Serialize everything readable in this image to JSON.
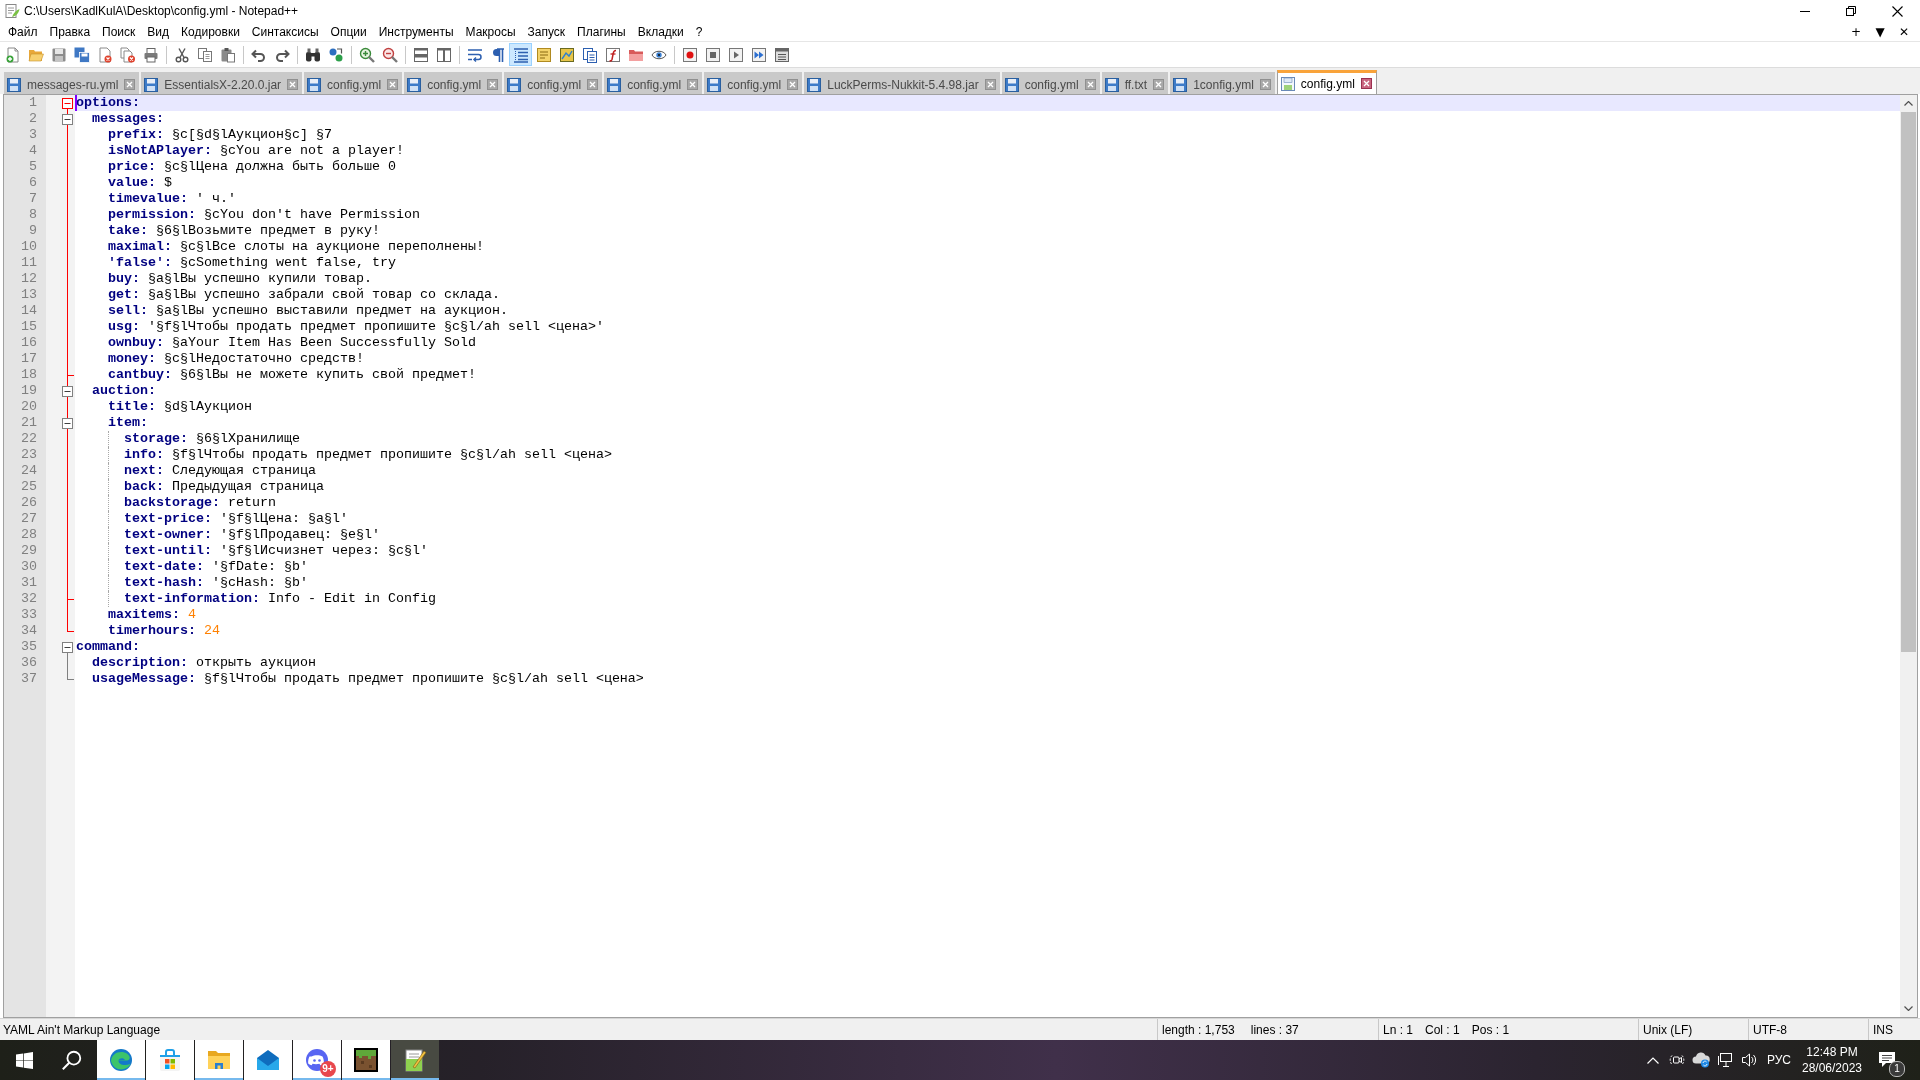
{
  "window": {
    "title": "C:\\Users\\KadlKulA\\Desktop\\config.yml - Notepad++"
  },
  "menu": [
    "Файл",
    "Правка",
    "Поиск",
    "Вид",
    "Кодировки",
    "Синтаксисы",
    "Опции",
    "Инструменты",
    "Макросы",
    "Запуск",
    "Плагины",
    "Вкладки",
    "?"
  ],
  "menu_bar_buttons": [
    "+",
    "▼",
    "✕"
  ],
  "toolbar": [
    [
      {
        "kind": "new",
        "pressed": false
      },
      {
        "kind": "open",
        "pressed": false
      },
      {
        "kind": "save",
        "pressed": false
      },
      {
        "kind": "save-all",
        "pressed": false
      },
      {
        "kind": "close",
        "pressed": false
      },
      {
        "kind": "close-all",
        "pressed": false
      },
      {
        "kind": "print",
        "pressed": false
      }
    ],
    [
      {
        "kind": "cut",
        "pressed": false
      },
      {
        "kind": "copy",
        "pressed": false
      },
      {
        "kind": "paste",
        "pressed": false
      }
    ],
    [
      {
        "kind": "undo",
        "pressed": false
      },
      {
        "kind": "redo",
        "pressed": false
      }
    ],
    [
      {
        "kind": "find",
        "pressed": false
      },
      {
        "kind": "replace",
        "pressed": false
      }
    ],
    [
      {
        "kind": "zoom-in",
        "pressed": false
      },
      {
        "kind": "zoom-out",
        "pressed": false
      }
    ],
    [
      {
        "kind": "sync-vertical",
        "pressed": false
      },
      {
        "kind": "sync-horizontal",
        "pressed": false
      }
    ],
    [
      {
        "kind": "word-wrap",
        "pressed": false
      },
      {
        "kind": "all-chars",
        "pressed": false
      },
      {
        "kind": "indent-guide",
        "pressed": true
      },
      {
        "kind": "udl",
        "pressed": false
      },
      {
        "kind": "doc-map",
        "pressed": false
      },
      {
        "kind": "doc-list",
        "pressed": false
      },
      {
        "kind": "function-list",
        "pressed": false
      },
      {
        "kind": "folder-workspace",
        "pressed": false
      },
      {
        "kind": "monitoring",
        "pressed": false
      }
    ],
    [
      {
        "kind": "record",
        "pressed": false
      },
      {
        "kind": "stop",
        "pressed": false
      },
      {
        "kind": "play",
        "pressed": false
      },
      {
        "kind": "play-multiple",
        "pressed": false
      },
      {
        "kind": "save-macro",
        "pressed": false
      }
    ]
  ],
  "tabs": [
    {
      "label": "messages-ru.yml",
      "selected": false
    },
    {
      "label": "EssentialsX-2.20.0.jar",
      "selected": false
    },
    {
      "label": "config.yml",
      "selected": false
    },
    {
      "label": "config.yml",
      "selected": false
    },
    {
      "label": "config.yml",
      "selected": false
    },
    {
      "label": "config.yml",
      "selected": false
    },
    {
      "label": "config.yml",
      "selected": false
    },
    {
      "label": "LuckPerms-Nukkit-5.4.98.jar",
      "selected": false
    },
    {
      "label": "config.yml",
      "selected": false
    },
    {
      "label": "ff.txt",
      "selected": false
    },
    {
      "label": "1config.yml",
      "selected": false
    },
    {
      "label": "config.yml",
      "selected": true
    }
  ],
  "editor": {
    "lines": [
      {
        "line": "1",
        "kind": "map",
        "key": "options:",
        "expanded": true,
        "caret": true,
        "children": [
          {
            "line": "2",
            "kind": "map",
            "key": "messages:",
            "expanded": true,
            "caret": false,
            "children": [
              {
                "line": "3",
                "kind": "text",
                "key": "prefix:",
                "value": "§c[§d§lАукцион§c] §7",
                "caret": false
              },
              {
                "line": "4",
                "kind": "text",
                "key": "isNotAPlayer:",
                "value": "§cYou are not a player!",
                "caret": false
              },
              {
                "line": "5",
                "kind": "text",
                "key": "price:",
                "value": "§c§lЦена должна быть больше 0",
                "caret": false
              },
              {
                "line": "6",
                "kind": "text",
                "key": "value:",
                "value": "$",
                "caret": false
              },
              {
                "line": "7",
                "kind": "text",
                "key": "timevalue:",
                "value": "' ч.'",
                "caret": false
              },
              {
                "line": "8",
                "kind": "text",
                "key": "permission:",
                "value": "§cYou don't have Permission",
                "caret": false
              },
              {
                "line": "9",
                "kind": "text",
                "key": "take:",
                "value": "§6§lВозьмите предмет в руку!",
                "caret": false
              },
              {
                "line": "10",
                "kind": "text",
                "key": "maximal:",
                "value": "§c§lВсе слоты на аукционе переполнены!",
                "caret": false
              },
              {
                "line": "11",
                "kind": "text",
                "key": "'false':",
                "value": "§cSomething went false, try",
                "caret": false
              },
              {
                "line": "12",
                "kind": "text",
                "key": "buy:",
                "value": "§a§lВы успешно купили товар.",
                "caret": false
              },
              {
                "line": "13",
                "kind": "text",
                "key": "get:",
                "value": "§a§lВы успешно забрали свой товар со склада.",
                "caret": false
              },
              {
                "line": "14",
                "kind": "text",
                "key": "sell:",
                "value": "§a§lВы успешно выставили предмет на аукцион.",
                "caret": false
              },
              {
                "line": "15",
                "kind": "text",
                "key": "usg:",
                "value": "'§f§lЧтобы продать предмет пропишите §c§l/ah sell <цена>'",
                "caret": false
              },
              {
                "line": "16",
                "kind": "text",
                "key": "ownbuy:",
                "value": "§aYour Item Has Been Successfully Sold",
                "caret": false
              },
              {
                "line": "17",
                "kind": "text",
                "key": "money:",
                "value": "§c§lНедостаточно средств!",
                "caret": false
              },
              {
                "line": "18",
                "kind": "text",
                "key": "cantbuy:",
                "value": "§6§lВы не можете купить свой предмет!",
                "caret": false
              }
            ]
          },
          {
            "line": "19",
            "kind": "map",
            "key": "auction:",
            "expanded": true,
            "caret": false,
            "children": [
              {
                "line": "20",
                "kind": "text",
                "key": "title:",
                "value": "§d§lАукцион",
                "caret": false
              },
              {
                "line": "21",
                "kind": "map",
                "key": "item:",
                "expanded": true,
                "caret": false,
                "children": [
                  {
                    "line": "22",
                    "kind": "text",
                    "key": "storage:",
                    "value": "§6§lХранилище",
                    "caret": false
                  },
                  {
                    "line": "23",
                    "kind": "text",
                    "key": "info:",
                    "value": "§f§lЧтобы продать предмет пропишите §c§l/ah sell <цена>",
                    "caret": false
                  },
                  {
                    "line": "24",
                    "kind": "text",
                    "key": "next:",
                    "value": "Следующая страница",
                    "caret": false
                  },
                  {
                    "line": "25",
                    "kind": "text",
                    "key": "back:",
                    "value": "Предыдущая страница",
                    "caret": false
                  },
                  {
                    "line": "26",
                    "kind": "text",
                    "key": "backstorage:",
                    "value": "return",
                    "caret": false
                  },
                  {
                    "line": "27",
                    "kind": "text",
                    "key": "text-price:",
                    "value": "'§f§lЦена: §a§l'",
                    "caret": false
                  },
                  {
                    "line": "28",
                    "kind": "text",
                    "key": "text-owner:",
                    "value": "'§f§lПродавец: §e§l'",
                    "caret": false
                  },
                  {
                    "line": "29",
                    "kind": "text",
                    "key": "text-until:",
                    "value": "'§f§lИсчизнет через: §c§l'",
                    "caret": false
                  },
                  {
                    "line": "30",
                    "kind": "text",
                    "key": "text-date:",
                    "value": "'§fDate: §b'",
                    "caret": false
                  },
                  {
                    "line": "31",
                    "kind": "text",
                    "key": "text-hash:",
                    "value": "'§cHash: §b'",
                    "caret": false
                  },
                  {
                    "line": "32",
                    "kind": "text",
                    "key": "text-information:",
                    "value": "Info - Edit in Config",
                    "caret": false
                  }
                ]
              },
              {
                "line": "33",
                "kind": "number",
                "key": "maxitems:",
                "value": "4",
                "caret": false
              },
              {
                "line": "34",
                "kind": "number",
                "key": "timerhours:",
                "value": "24",
                "caret": false
              }
            ]
          }
        ]
      },
      {
        "line": "35",
        "kind": "map",
        "key": "command:",
        "expanded": true,
        "caret": false,
        "children": [
          {
            "line": "36",
            "kind": "text",
            "key": "description:",
            "value": "открыть аукцион",
            "caret": false
          },
          {
            "line": "37",
            "kind": "text",
            "key": "usageMessage:",
            "value": "§f§lЧтобы продать предмет пропишите §c§l/ah sell <цена>",
            "caret": false
          }
        ]
      }
    ]
  },
  "status_bar": [
    [
      "YAML Ain't Markup Language"
    ],
    [
      "length : 1,753",
      "lines : 37"
    ],
    [
      "Ln : 1",
      "Col : 1",
      "Pos : 1"
    ],
    [
      "Unix (LF)"
    ],
    [
      "UTF-8"
    ],
    [
      "INS"
    ]
  ],
  "taskbar": {
    "apps": [
      {
        "kind": "browser",
        "running": true,
        "active": false
      },
      {
        "kind": "store",
        "running": false,
        "active": false
      },
      {
        "kind": "file-manager",
        "running": true,
        "active": false
      },
      {
        "kind": "mail",
        "running": false,
        "active": false
      },
      {
        "kind": "chat",
        "running": true,
        "active": false,
        "badge": "9+"
      },
      {
        "kind": "game",
        "running": true,
        "active": false
      },
      {
        "kind": "text-editor",
        "running": true,
        "active": true
      }
    ],
    "tray": {
      "language": "РУС",
      "time": "12:48 PM",
      "date": "28/06/2023",
      "notifications": "1"
    }
  }
}
